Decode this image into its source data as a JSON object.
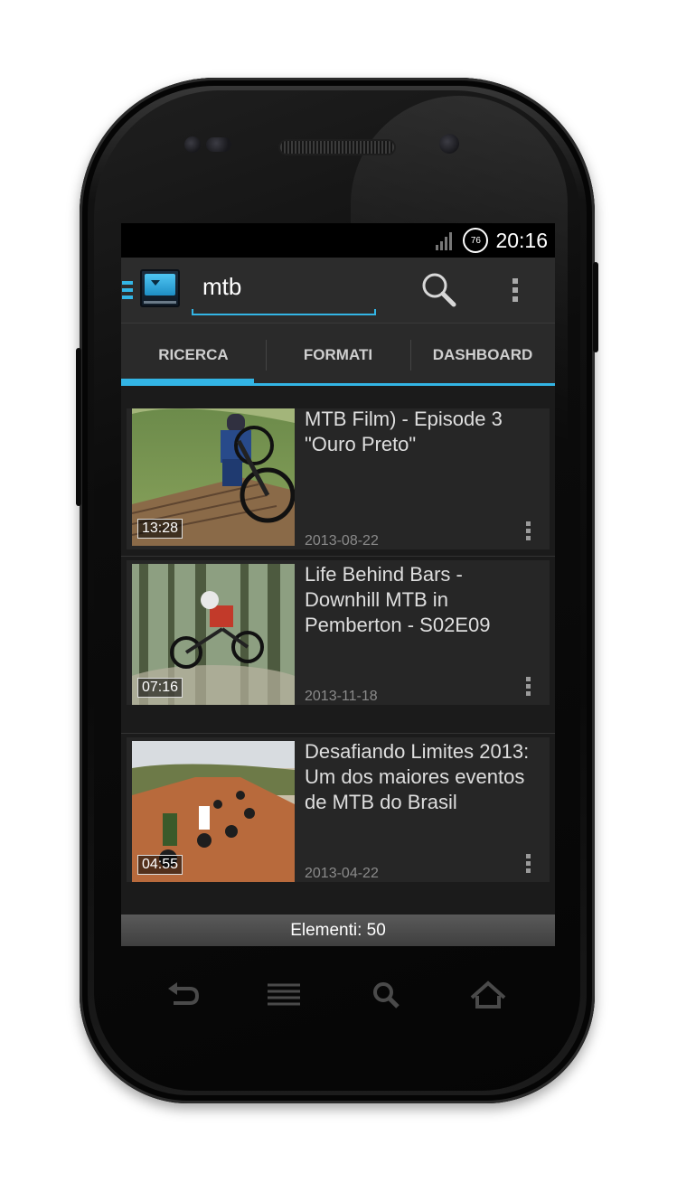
{
  "status_bar": {
    "battery": "76",
    "time": "20:16"
  },
  "action_bar": {
    "search_value": "mtb",
    "search_placeholder": "",
    "search_icon": "search-icon",
    "overflow_icon": "overflow-menu-icon",
    "app_icon": "tv-app-icon",
    "drawer_icon": "drawer-icon"
  },
  "tabs": [
    {
      "label": "RICERCA",
      "selected": true
    },
    {
      "label": "FORMATI",
      "selected": false
    },
    {
      "label": "DASHBOARD",
      "selected": false
    }
  ],
  "videos": [
    {
      "title": "MTB Film) - Episode 3 \"Ouro Preto\"",
      "date": "2013-08-22",
      "duration": "13:28"
    },
    {
      "title": "Life Behind Bars - Downhill MTB in Pemberton - S02E09",
      "date": "2013-11-18",
      "duration": "07:16"
    },
    {
      "title": "Desafiando Limites 2013: Um dos maiores eventos de MTB do Brasil",
      "date": "2013-04-22",
      "duration": "04:55"
    }
  ],
  "footer": {
    "count_label": "Elementi: 50"
  },
  "nav_keys": [
    "back-icon",
    "menu-icon",
    "search-icon",
    "home-icon"
  ],
  "colors": {
    "accent": "#33b5e5",
    "background": "#1b1b1b",
    "row": "#262626"
  }
}
